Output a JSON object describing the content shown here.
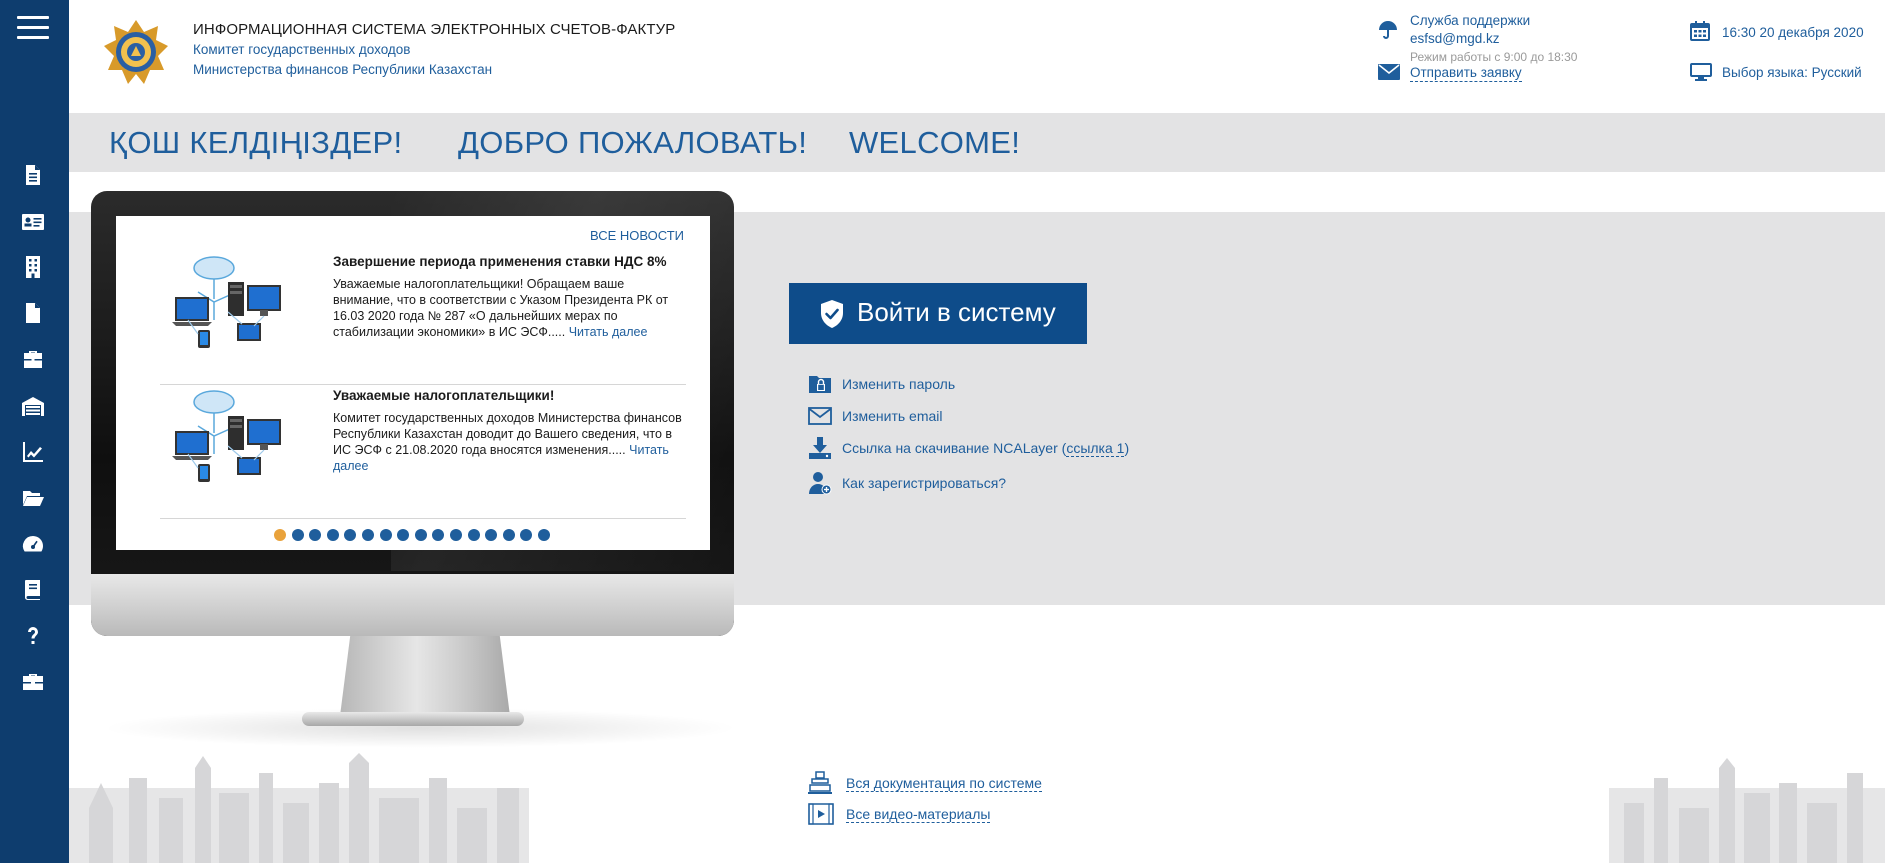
{
  "header": {
    "title": "ИНФОРМАЦИОННАЯ СИСТЕМА ЭЛЕКТРОННЫХ СЧЕТОВ-ФАКТУР",
    "subtitle_1": "Комитет государственных доходов",
    "subtitle_2": "Министерства финансов Республики Казахстан",
    "support": {
      "title": "Служба поддержки",
      "email": "esfsd@mgd.kz",
      "hours": "Режим работы с 9:00 до 18:30",
      "request_link": "Отправить заявку"
    },
    "datetime": "16:30 20 декабря 2020",
    "language": "Выбор языка: Русский"
  },
  "welcome": {
    "kz": "ҚОШ КЕЛДІҢІЗДЕР!",
    "ru": "ДОБРО ПОЖАЛОВАТЬ!",
    "en": "WELCOME!"
  },
  "news": {
    "all_link": "ВСЕ НОВОСТИ",
    "items": [
      {
        "title": "Завершение периода применения ставки НДС 8%",
        "text": "Уважаемые налогоплательщики! Обращаем ваше внимание, что в соответствии с Указом Президента РК от 16.03 2020 года № 287 «О дальнейших мерах по стабилизации экономики» в ИС ЭСФ.....",
        "read_more": "Читать далее"
      },
      {
        "title": "Уважаемые налогоплательщики!",
        "text": "Комитет государственных доходов Министерства финансов Республики Казахстан доводит до Вашего сведения, что в ИС ЭСФ с 21.08.2020 года вносятся изменения.....",
        "read_more": "Читать далее"
      }
    ],
    "dots_total": 16,
    "dots_active_index": 0
  },
  "login": {
    "button_label": "Войти в систему",
    "links": {
      "change_password": "Изменить пароль",
      "change_email": "Изменить email",
      "ncalayer": "Ссылка на скачивание NCALayer (",
      "ncalayer_link": "ссылка 1",
      "ncalayer_close": ")",
      "register": "Как зарегистрироваться?"
    }
  },
  "docs": {
    "all_docs": "Вся документация по системе",
    "all_videos": "Все видео-материалы"
  },
  "sidebar": {
    "icons": [
      "document-icon",
      "id-card-icon",
      "building-icon",
      "file-icon",
      "briefcase-icon",
      "warehouse-icon",
      "chart-icon",
      "folder-open-icon",
      "dashboard-icon",
      "book-icon",
      "help-icon",
      "toolbox-icon"
    ]
  },
  "colors": {
    "sidebar": "#0e3d6e",
    "accent": "#1f5e9c",
    "button": "#0e4c8a",
    "panel": "#e3e3e4",
    "dot_active": "#e9a23b"
  }
}
